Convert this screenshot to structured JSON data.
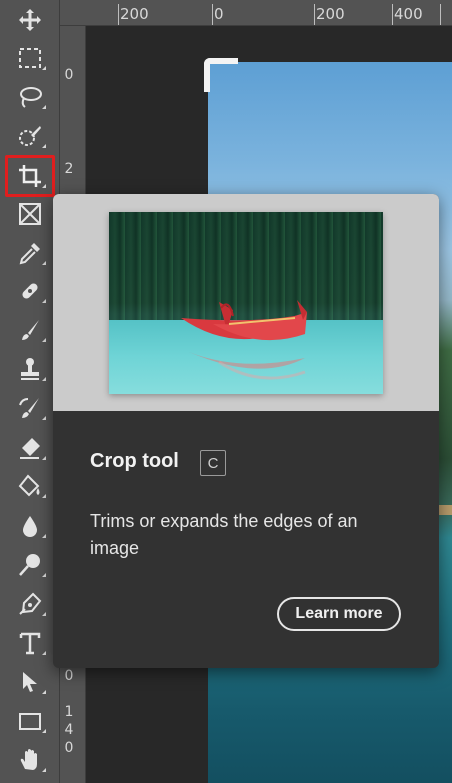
{
  "toolbar": {
    "active_tool": "crop-tool",
    "tools": [
      {
        "name": "move-tool",
        "icon": "move-icon"
      },
      {
        "name": "marquee-tool",
        "icon": "rectangular-marquee-icon"
      },
      {
        "name": "lasso-tool",
        "icon": "lasso-icon"
      },
      {
        "name": "object-selection-tool",
        "icon": "object-selection-icon"
      },
      {
        "name": "crop-tool",
        "icon": "crop-icon"
      },
      {
        "name": "frame-tool",
        "icon": "frame-icon"
      },
      {
        "name": "eyedropper-tool",
        "icon": "eyedropper-icon"
      },
      {
        "name": "healing-brush-tool",
        "icon": "bandage-icon"
      },
      {
        "name": "brush-tool",
        "icon": "brush-icon"
      },
      {
        "name": "clone-stamp-tool",
        "icon": "stamp-icon"
      },
      {
        "name": "history-brush-tool",
        "icon": "history-brush-icon"
      },
      {
        "name": "eraser-tool",
        "icon": "eraser-icon"
      },
      {
        "name": "paint-bucket-tool",
        "icon": "paint-bucket-icon"
      },
      {
        "name": "blur-tool",
        "icon": "drop-icon"
      },
      {
        "name": "dodge-tool",
        "icon": "dodge-icon"
      },
      {
        "name": "pen-tool",
        "icon": "pen-icon"
      },
      {
        "name": "type-tool",
        "icon": "type-icon"
      },
      {
        "name": "path-selection-tool",
        "icon": "arrow-icon"
      },
      {
        "name": "rectangle-tool",
        "icon": "rectangle-icon"
      },
      {
        "name": "hand-tool",
        "icon": "hand-icon"
      }
    ]
  },
  "ruler": {
    "top_labels": [
      "200",
      "0",
      "200",
      "400"
    ],
    "left_labels": [
      "0",
      "2",
      "0",
      "1",
      "4",
      "0"
    ]
  },
  "tooltip": {
    "title": "Crop tool",
    "shortcut": "C",
    "description": "Trims or expands the edges of an image",
    "learn_more": "Learn more"
  },
  "colors": {
    "active_outline": "#e01e1e",
    "toolbar_bg": "#535353",
    "popup_bg": "#323232"
  }
}
